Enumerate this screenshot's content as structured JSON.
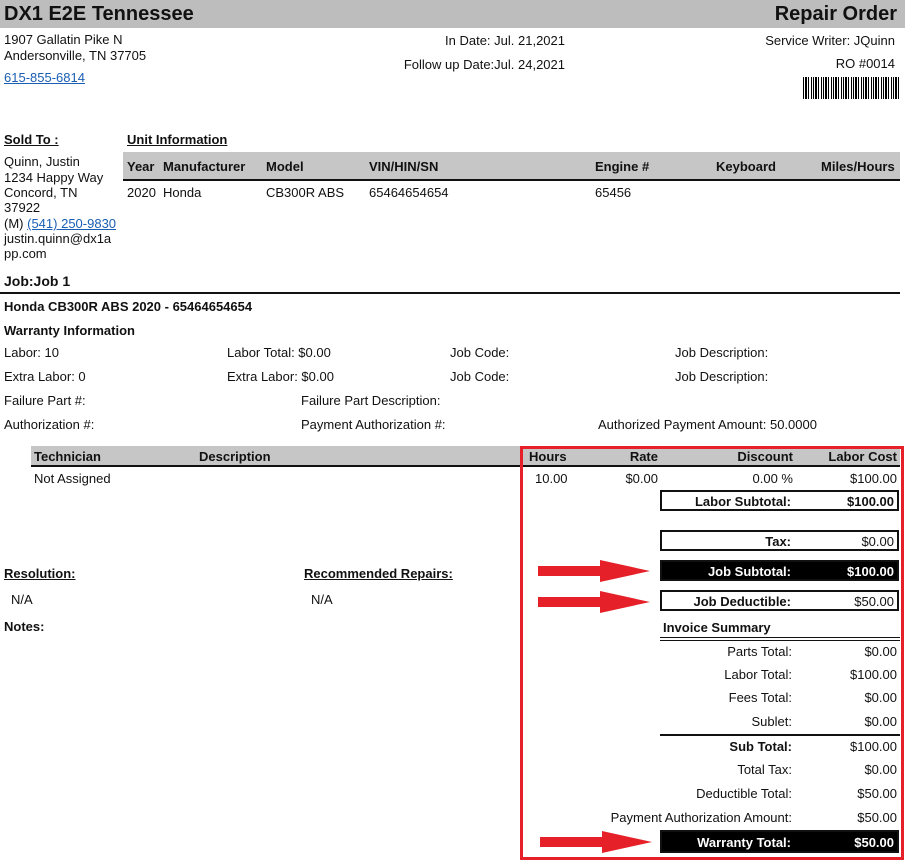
{
  "company": {
    "name": "DX1 E2E Tennessee",
    "address1": "1907 Gallatin Pike N",
    "address2": "Andersonville, TN 37705",
    "phone": "615-855-6814"
  },
  "document": {
    "title": "Repair Order",
    "in_date": "In Date: Jul. 21,2021",
    "follow_up": "Follow up Date:Jul. 24,2021",
    "service_writer": "Service Writer: JQuinn",
    "ro_number": "RO #0014"
  },
  "sold_to": {
    "heading": "Sold To :",
    "lines": [
      "Quinn, Justin",
      "1234 Happy Way",
      "Concord, TN",
      "37922"
    ],
    "phone_prefix": "(M)",
    "phone": "(541) 250-9830",
    "email_1": "justin.quinn@dx1a",
    "email_2": "pp.com"
  },
  "unit": {
    "heading": "Unit Information",
    "columns": [
      "Year",
      "Manufacturer",
      "Model",
      "VIN/HIN/SN",
      "Engine #",
      "Keyboard",
      "Miles/Hours"
    ],
    "row": [
      "2020",
      "Honda",
      "CB300R ABS",
      "65464654654",
      "65456",
      "",
      ""
    ]
  },
  "job": {
    "title": "Job:Job 1",
    "vehicle": "Honda CB300R ABS 2020 - 65464654654",
    "warranty_heading": "Warranty Information",
    "labor": "Labor: 10",
    "labor_total": "Labor Total: $0.00",
    "job_code_1": "Job Code:",
    "job_desc_1": "Job Description:",
    "extra_labor": "Extra Labor: 0",
    "extra_labor_total": "Extra Labor: $0.00",
    "job_code_2": "Job Code:",
    "job_desc_2": "Job Description:",
    "failure_part": "Failure Part #:",
    "failure_part_desc": "Failure Part Description:",
    "authorization": "Authorization #:",
    "payment_authorization": "Payment Authorization #:",
    "authorized_payment_amount": "Authorized Payment Amount: 50.0000"
  },
  "labor_table": {
    "columns": [
      "Technician",
      "Description",
      "Hours",
      "Rate",
      "Discount",
      "Labor Cost"
    ],
    "row": [
      "Not Assigned",
      "",
      "10.00",
      "$0.00",
      "0.00 %",
      "$100.00"
    ]
  },
  "subtotals": {
    "labor_subtotal_label": "Labor Subtotal:",
    "labor_subtotal": "$100.00",
    "tax_label": "Tax:",
    "tax": "$0.00",
    "job_subtotal_label": "Job Subtotal:",
    "job_subtotal": "$100.00",
    "job_deductible_label": "Job Deductible:",
    "job_deductible": "$50.00"
  },
  "resolution": {
    "heading": "Resolution:",
    "value": "N/A"
  },
  "recommended": {
    "heading": "Recommended Repairs:",
    "value": "N/A"
  },
  "notes_heading": "Notes:",
  "invoice_summary": {
    "heading": "Invoice Summary",
    "parts_label": "Parts Total:",
    "parts": "$0.00",
    "labor_label": "Labor Total:",
    "labor": "$100.00",
    "fees_label": "Fees Total:",
    "fees": "$0.00",
    "sublet_label": "Sublet:",
    "sublet": "$0.00",
    "sub_total_label": "Sub Total:",
    "sub_total": "$100.00",
    "total_tax_label": "Total Tax:",
    "total_tax": "$0.00",
    "deductible_label": "Deductible Total:",
    "deductible": "$50.00",
    "payment_auth_label": "Payment Authorization Amount:",
    "payment_auth": "$50.00",
    "warranty_total_label": "Warranty Total:",
    "warranty_total": "$50.00"
  },
  "colors": {
    "highlight": "#e52029",
    "header_gray": "#bdbdbd"
  }
}
